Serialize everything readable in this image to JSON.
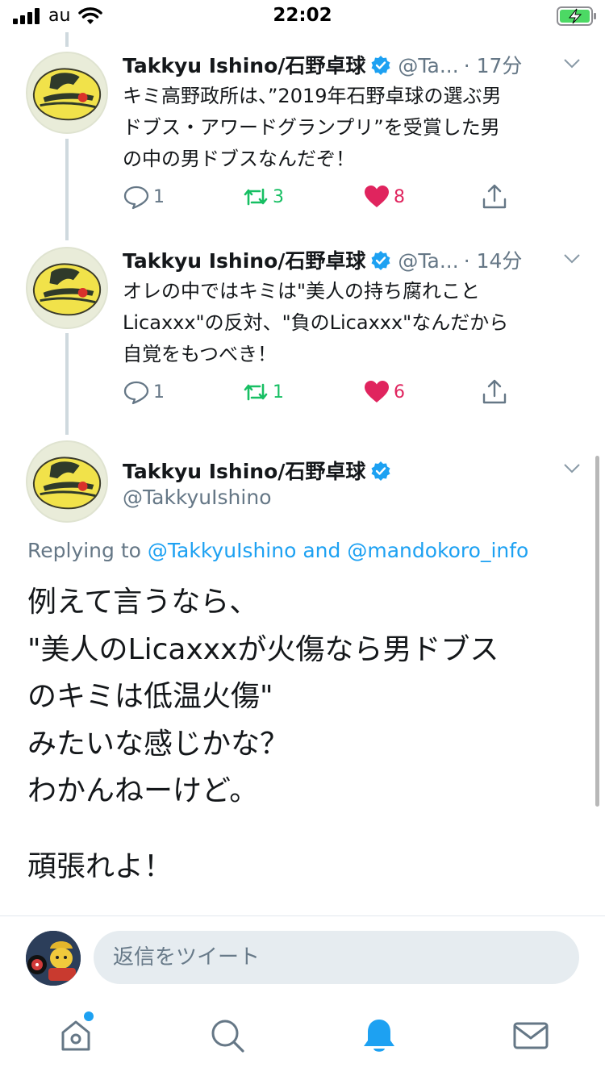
{
  "status_bar": {
    "carrier": "au",
    "time": "22:02"
  },
  "colors": {
    "accent": "#1da1f2",
    "retweet": "#17bf63",
    "like": "#e0245e",
    "muted": "#657786"
  },
  "tweets": [
    {
      "name": "Takkyu Ishino/石野卓球",
      "handle": "@Ta...",
      "time": "· 17分",
      "text": "キミ高野政所は、”2019年石野卓球の選ぶ男\nドブス・アワードグランプリ”を受賞した男\nの中の男ドブスなんだぞ！",
      "replies": "1",
      "retweets": "3",
      "likes": "8"
    },
    {
      "name": "Takkyu Ishino/石野卓球",
      "handle": "@Ta...",
      "time": "· 14分",
      "text": "オレの中ではキミは\"美人の持ち腐れこと\nLicaxxx\"の反対、\"負のLicaxxx\"なんだから\n自覚をもつべき！",
      "replies": "1",
      "retweets": "1",
      "likes": "6"
    }
  ],
  "main_tweet": {
    "name": "Takkyu Ishino/石野卓球",
    "handle": "@TakkyuIshino",
    "replying_prefix": "Replying to",
    "replying_user1": "@TakkyuIshino",
    "replying_and": "and",
    "replying_user2": "@mandokoro_info",
    "text": "例えて言うなら、\n\"美人のLicaxxxが火傷なら男ドブス\nのキミは低温火傷\"\nみたいな感じかな？\nわかんねーけど。",
    "text2": "頑張れよ！"
  },
  "reply_box": {
    "placeholder": "返信をツイート"
  },
  "tab_bar": {
    "icons": [
      "home-icon",
      "search-icon",
      "notifications-icon",
      "messages-icon"
    ],
    "active": "notifications-icon"
  }
}
